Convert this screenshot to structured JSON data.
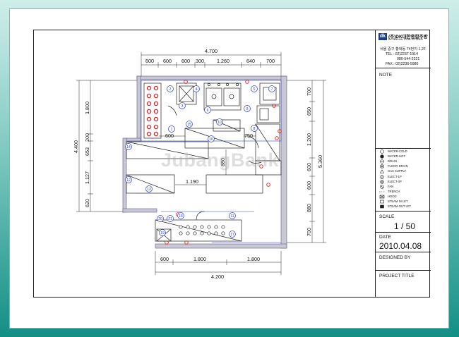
{
  "company": {
    "logo_mark": "dk",
    "name": "(주)DK대한종합주방",
    "subname": "DK DAEHAN TOTAL KITCHEN",
    "address": "서울 중구 황학동 74번지 1,2F",
    "tel": "TEL : 02)2237-1914",
    "tel2": "080-544-2221",
    "fax": "FAX : 02)2236-5980"
  },
  "note_label": "NOTE",
  "legend": [
    {
      "icon": "circle-outline-icon",
      "label": "WATER-COLD"
    },
    {
      "icon": "circle-filled-icon",
      "label": "WATER-HOT"
    },
    {
      "icon": "drain-icon",
      "label": "DRAIN"
    },
    {
      "icon": "floor-drain-icon",
      "label": "FLOOR DRAIN"
    },
    {
      "icon": "triangle-icon",
      "label": "GAS SUPPLY"
    },
    {
      "icon": "elect-1p-icon",
      "label": "ELECT-1P"
    },
    {
      "icon": "elect-3p-icon",
      "label": "ELECT-3P"
    },
    {
      "icon": "fan-icon",
      "label": "FAN"
    },
    {
      "icon": "trench-icon",
      "label": "TRENCH"
    },
    {
      "icon": "hood-icon",
      "label": "HOOD"
    },
    {
      "icon": "steam-in-icon",
      "label": "STEAM IN LET"
    },
    {
      "icon": "steam-out-icon",
      "label": "STEAM OUT LET"
    }
  ],
  "scale": {
    "label": "SCALE",
    "value": "1 / 50"
  },
  "date": {
    "label": "DATE",
    "value": "2010.04.08"
  },
  "designed_by_label": "DESIGNED BY",
  "project_title_label": "PROJECT TITLE",
  "watermark": "JubangBank",
  "dimensions": {
    "top_total": "4.700",
    "top_parts": [
      "600",
      "600",
      "600",
      "300",
      "1.260",
      "640",
      "700"
    ],
    "bottom_total": "4.200",
    "bottom_parts": [
      "600",
      "1.800",
      "1.800"
    ],
    "left_total": "4.400",
    "left_parts": [
      "1.800",
      "200",
      "653",
      "1.127",
      "620"
    ],
    "right_total": "5.360",
    "right_parts": [
      "700",
      "650",
      "1.200",
      "600",
      "600",
      "880",
      "700"
    ],
    "inner": [
      "600",
      "750",
      "880",
      "1.190"
    ]
  },
  "equipment_numbers": [
    "1",
    "2",
    "3",
    "4",
    "5",
    "6",
    "7",
    "8",
    "9",
    "10",
    "11",
    "12",
    "13",
    "14",
    "15",
    "16",
    "17",
    "18",
    "19",
    "20",
    "21"
  ]
}
